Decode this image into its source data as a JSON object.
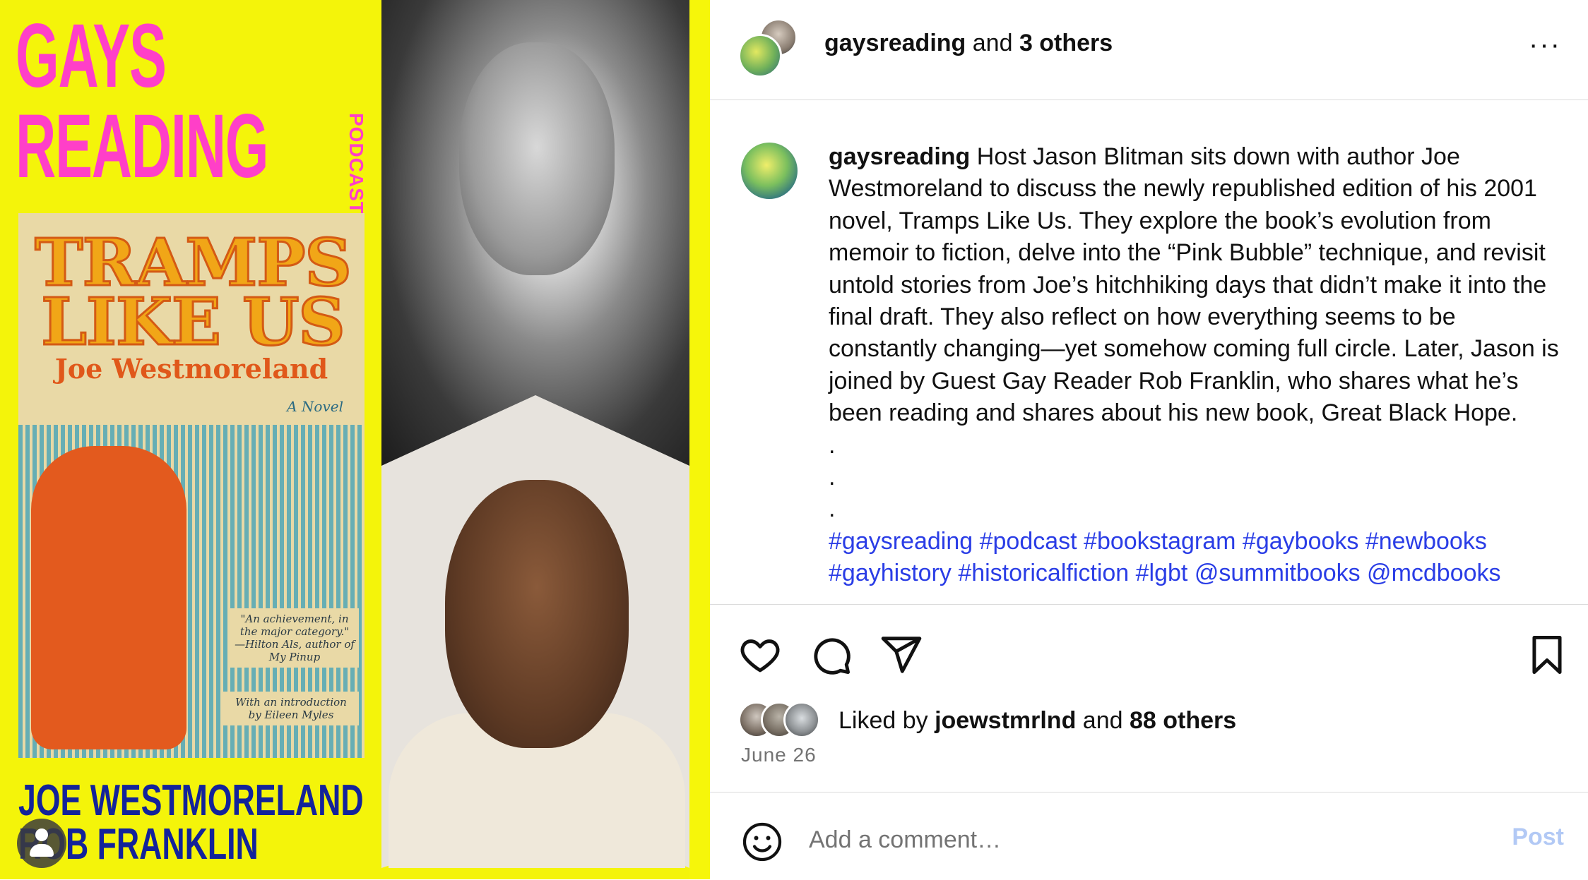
{
  "media": {
    "poster_title_line1": "GAYS",
    "poster_title_line2": "READING",
    "poster_vertical": "PODCAST",
    "book_title": "TRAMPS LIKE US",
    "book_author": "Joe Westmoreland",
    "book_tag": "A Novel",
    "book_blurb": "\"An achievement, in the major category.\" —Hilton Als, author of My Pinup",
    "book_intro": "With an introduction by Eileen Myles",
    "guest_line1": "JOE WESTMORELAND",
    "guest_line2": "ROB FRANKLIN"
  },
  "header": {
    "username": "gaysreading",
    "and_text": " and ",
    "others": "3 others",
    "more_icon": "···"
  },
  "caption": {
    "username": "gaysreading",
    "text": " Host Jason Blitman sits down with author Joe Westmoreland to discuss the newly republished edition of his 2001 novel, Tramps Like Us. They explore the book’s evolution from memoir to fiction, delve into the “Pink Bubble” technique, and revisit untold stories from Joe’s hitchhiking days that didn’t make it into the final draft. They also reflect on how everything seems to be constantly changing—yet somehow coming full circle. Later, Jason is joined by Guest Gay Reader Rob Franklin, who shares what he’s been reading and shares about his new book, Great Black Hope.",
    "dot": ".",
    "hashtags_line1": "#gaysreading #podcast #bookstagram #gaybooks #newbooks",
    "hashtags_line2": "#gayhistory #historicalfiction #lgbt @summitbooks @mcdbooks"
  },
  "icons": {
    "like": "heart-icon",
    "comment": "comment-icon",
    "share": "share-icon",
    "save": "bookmark-icon",
    "emoji": "emoji-icon"
  },
  "likes": {
    "prefix": "Liked by ",
    "user": "joewstmrlnd",
    "and_text": " and ",
    "others": "88 others"
  },
  "date": "June 26",
  "comment": {
    "placeholder": "Add a comment…",
    "post_label": "Post"
  },
  "colors": {
    "poster_yellow": "#f4f40a",
    "poster_pink": "#ff3fc8",
    "poster_blue": "#13239a",
    "hashtag_blue": "#2a3de6",
    "post_disabled": "#b2c9f5"
  }
}
